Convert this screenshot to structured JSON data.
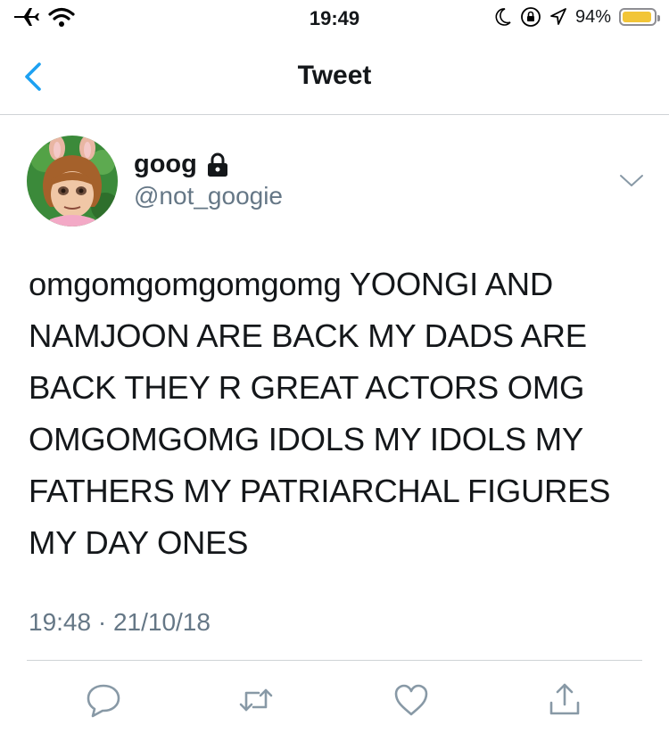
{
  "status_bar": {
    "time": "19:49",
    "battery_percent": "94%",
    "battery_level": 0.94,
    "icons": [
      "airplane-icon",
      "wifi-icon",
      "moon-icon",
      "orientation-lock-icon",
      "location-icon",
      "battery-icon"
    ]
  },
  "nav": {
    "title": "Tweet",
    "back_icon": "chevron-left-icon"
  },
  "tweet": {
    "author": {
      "name": "goog",
      "handle": "@not_googie",
      "protected_icon": "lock-icon"
    },
    "lines": [
      "omgomgomgomgomg YOONGI AND",
      "NAMJOON ARE BACK MY DADS ARE",
      "BACK THEY R GREAT ACTORS OMG",
      "OMGOMGOMG IDOLS MY IDOLS MY",
      "FATHERS MY PATRIARCHAL FIGURES",
      "MY DAY ONES"
    ],
    "timestamp": "19:48 · 21/10/18"
  },
  "actions": [
    "reply-icon",
    "retweet-icon",
    "like-icon",
    "share-icon"
  ],
  "colors": {
    "accent": "#1da1f2",
    "muted": "#657786",
    "action_icon": "#8899a6",
    "battery": "#f2c537"
  }
}
